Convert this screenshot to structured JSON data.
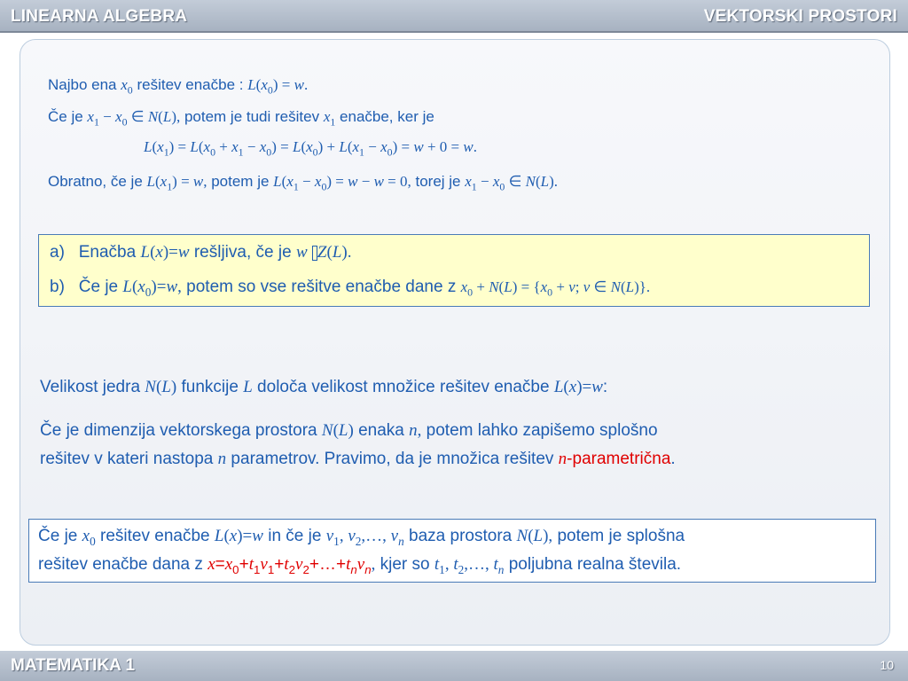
{
  "header": {
    "left": "LINEARNA ALGEBRA",
    "right": "VEKTORSKI  PROSTORI"
  },
  "footer": {
    "left": "MATEMATIKA 1",
    "page": "10"
  },
  "intro": {
    "l1_a": "Najbo  ena  ",
    "l1_b": "  rešitev  enačbe : ",
    "l2_a": "Če  je  ",
    "l2_b": "  potem  je  tudi  rešitev ",
    "l2_c": " enačbe, ker je",
    "l4_a": "Obratno,  če  je  ",
    "l4_b": "  potem  je  ",
    "l4_c": "  torej je  "
  },
  "box1": {
    "a_label": "a)",
    "a_text1": "Enačba ",
    "a_text2": " rešljiva, če je ",
    "a_sym": " ",
    "b_label": "b)",
    "b_text1": "Če je ",
    "b_text2": " potem so vse rešitve enačbe dane z "
  },
  "para1": {
    "t1": "Velikost jedra ",
    "t2": " funkcije ",
    "t3": " določa velikost množice rešitev enačbe ",
    "t4": ":"
  },
  "para2": {
    "t1": "Če je dimenzija vektorskega prostora ",
    "t2": "  enaka ",
    "t3": " potem lahko zapišemo splošno",
    "t4": "rešitev v kateri nastopa ",
    "t5": " parametrov. Pravimo, da je množica rešitev ",
    "t6": "-parametrična",
    "t7": "."
  },
  "box2": {
    "t1": "Če je ",
    "t2": " rešitev enačbe ",
    "t3": " in če je ",
    "t4": " baza prostora ",
    "t5": " potem je splošna",
    "t6": "rešitev enačbe dana z ",
    "t7": " kjer so ",
    "t8": " poljubna realna števila."
  },
  "colors": {
    "text": "#1f5db0",
    "accent": "#e00000",
    "box_fill": "#ffffcc"
  }
}
